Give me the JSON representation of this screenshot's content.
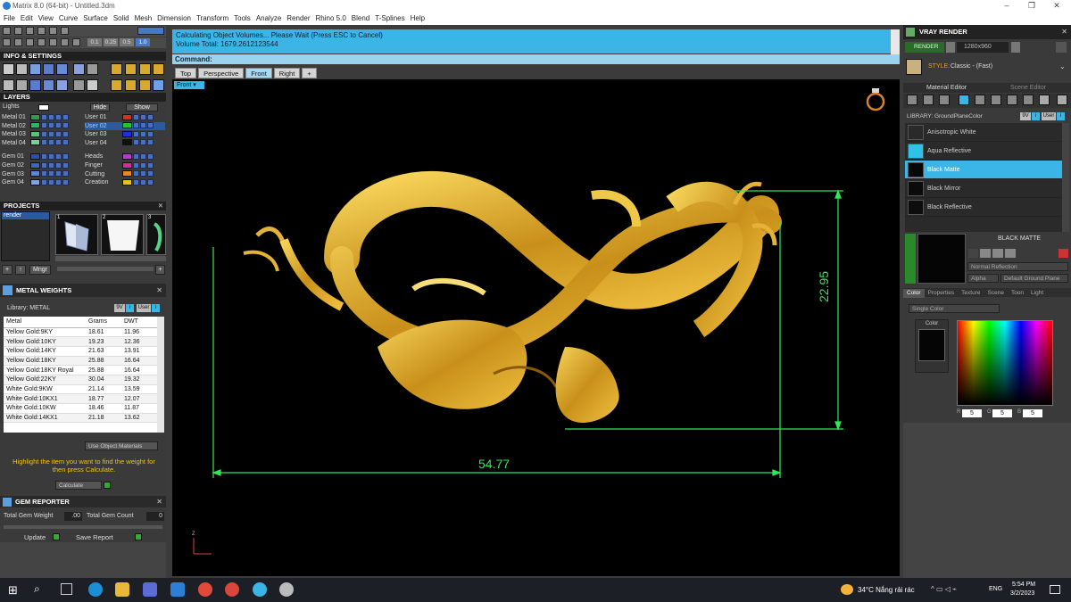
{
  "window": {
    "title": "Matrix 8.0 (64-bit) - Untitled.3dm",
    "controls": [
      "–",
      "❐",
      "✕"
    ]
  },
  "menu": [
    "File",
    "Edit",
    "View",
    "Curve",
    "Surface",
    "Solid",
    "Mesh",
    "Dimension",
    "Transform",
    "Tools",
    "Analyze",
    "Render",
    "Rhino 5.0",
    "Blend",
    "T-Splines",
    "Help"
  ],
  "toolbar": {
    "fields": [
      "0.1",
      "0.25",
      "0.5",
      "1.0"
    ]
  },
  "info_settings": {
    "title": "INFO & SETTINGS"
  },
  "layers": {
    "title": "LAYERS",
    "lights_label": "Lights",
    "hide_label": "Hide",
    "show_label": "Show",
    "left": [
      {
        "name": "Metal 01",
        "color": "#2e9b55"
      },
      {
        "name": "Metal 02",
        "color": "#33b06a"
      },
      {
        "name": "Metal 03",
        "color": "#52c77c"
      },
      {
        "name": "Metal 04",
        "color": "#74d39a"
      },
      {
        "name": "Gem 01",
        "color": "#2b4fb3"
      },
      {
        "name": "Gem 02",
        "color": "#3b63c8"
      },
      {
        "name": "Gem 03",
        "color": "#5b86d9"
      },
      {
        "name": "Gem 04",
        "color": "#7ba5e6"
      }
    ],
    "right": [
      {
        "name": "User 01",
        "color": "#d62c2c"
      },
      {
        "name": "User 02",
        "color": "#27c427"
      },
      {
        "name": "User 03",
        "color": "#2030d8"
      },
      {
        "name": "User 04",
        "color": "#101010"
      },
      {
        "name": "Heads",
        "color": "#b23bd0"
      },
      {
        "name": "Finger",
        "color": "#d02f9c"
      },
      {
        "name": "Cutting",
        "color": "#e58a2a"
      },
      {
        "name": "Creation",
        "color": "#e8c02a"
      }
    ]
  },
  "projects": {
    "title": "PROJECTS",
    "item": "render",
    "thumb_numbers": [
      "1",
      "2",
      "3"
    ],
    "btn_mngr": "Mngr"
  },
  "metal_weights": {
    "title": "METAL WEIGHTS",
    "library_label": "Library: METAL",
    "library_buttons": [
      "9V",
      "i",
      "User",
      "i"
    ],
    "columns": [
      "Metal",
      "Grams",
      "DWT"
    ],
    "rows": [
      [
        "Yellow Gold:9KY",
        "18.61",
        "11.96"
      ],
      [
        "Yellow Gold:10KY",
        "19.23",
        "12.36"
      ],
      [
        "Yellow Gold:14KY",
        "21.63",
        "13.91"
      ],
      [
        "Yellow Gold:18KY",
        "25.88",
        "16.64"
      ],
      [
        "Yellow Gold:18KY Royal",
        "25.88",
        "16.64"
      ],
      [
        "Yellow Gold:22KY",
        "30.04",
        "19.32"
      ],
      [
        "White Gold:9KW",
        "21.14",
        "13.59"
      ],
      [
        "White Gold:10KX1",
        "18.77",
        "12.07"
      ],
      [
        "White Gold:10KW",
        "18.46",
        "11.87"
      ],
      [
        "White Gold:14KX1",
        "21.18",
        "13.62"
      ]
    ],
    "use_object_materials": "Use Object Materials",
    "instruction": "Highlight the item you want to find the weight for then press Calculate.",
    "calculate": "Calculate"
  },
  "gem_reporter": {
    "title": "GEM REPORTER",
    "total_weight_label": "Total Gem Weight",
    "total_weight_value": ".00",
    "total_count_label": "Total Gem Count",
    "total_count_value": "0",
    "update": "Update",
    "save_report": "Save Report"
  },
  "status": {
    "line1": "Calculating Object Volumes... Please Wait (Press ESC to Cancel)",
    "line2": "Volume Total: 1679.2612123544",
    "command_label": "Command:"
  },
  "viewport_tabs": [
    "Top",
    "Perspective",
    "Front",
    "Right",
    "+"
  ],
  "active_tab": "Front",
  "viewport": {
    "label": "Front",
    "dim_width": "54.77",
    "dim_height": "22.95",
    "axis_label": "Z"
  },
  "vray": {
    "title": "VRAY RENDER",
    "render_btn": "RENDER",
    "resolution": "1280x960",
    "style_label": "STYLE:",
    "style_value": "Classic - (Fast)",
    "tabs": [
      "Material Editor",
      "Scene Editor"
    ],
    "library_label": "LIBRARY: GroundPlaneColor",
    "library_buttons": [
      "9V",
      "i",
      "User",
      "i"
    ],
    "materials": [
      {
        "name": "Anisotropic White",
        "color": "#2a2a2a"
      },
      {
        "name": "Aqua Reflective",
        "color": "#2fc2e8"
      },
      {
        "name": "Black Matte",
        "color": "#070707"
      },
      {
        "name": "Black Mirror",
        "color": "#0b0b0b"
      },
      {
        "name": "Black Reflective",
        "color": "#0d0d0d"
      }
    ],
    "selected_material": "Black Matte",
    "preview_title": "BLACK MATTE",
    "reflection": "Normal Reflection",
    "alpha": "Alpha",
    "ground": "Default Ground Plane",
    "subtabs": [
      "Color",
      "Properties",
      "Texture",
      "Scene",
      "Toon",
      "Light"
    ],
    "color_mode": "Single Color",
    "color_label": "Color",
    "rgb": [
      "5",
      "5",
      "5"
    ],
    "rgb_letters": [
      "R",
      "G",
      "B"
    ]
  },
  "taskbar": {
    "weather": "34°C  Nắng rải rác",
    "lang": "ENG",
    "time": "5:54 PM",
    "date": "3/2/2023"
  },
  "colors": {
    "accent_blue": "#3bb5e5",
    "dim_green": "#2ee85a",
    "gold": "#d9a520"
  }
}
